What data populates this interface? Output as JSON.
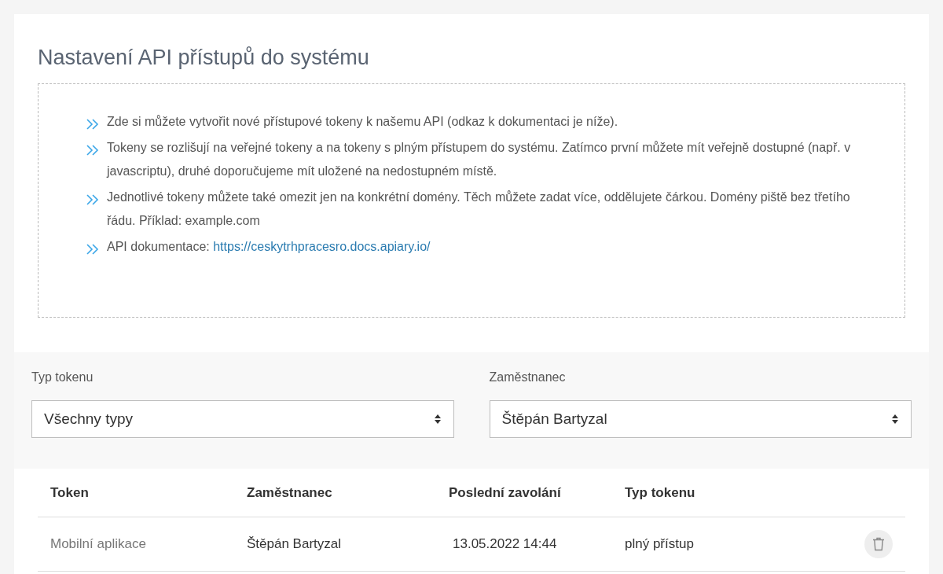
{
  "title": "Nastavení API přístupů do systému",
  "info_items": [
    {
      "text": "Zde si můžete vytvořit nové přístupové tokeny k našemu API (odkaz k dokumentaci je níže)."
    },
    {
      "text": "Tokeny se rozlišují na veřejné tokeny a na tokeny s plným přístupem do systému. Zatímco první můžete mít veřejně dostupné (např. v javascriptu), druhé doporučujeme mít uložené na nedostupném místě."
    },
    {
      "text": "Jednotlivé tokeny můžete také omezit jen na konkrétní domény. Těch můžete zadat více, oddělujete čárkou. Domény piště bez třetího řádu. Příklad: example.com"
    },
    {
      "text": "API dokumentace:",
      "link": "https://ceskytrhpracesro.docs.apiary.io/"
    }
  ],
  "filters": [
    {
      "label": "Typ tokenu",
      "value": "Všechny typy"
    },
    {
      "label": "Zaměstnanec",
      "value": "Štěpán Bartyzal"
    }
  ],
  "table": {
    "columns": [
      "Token",
      "Zaměstnanec",
      "Poslední zavolání",
      "Typ tokenu"
    ],
    "rows": [
      {
        "token": "Mobilní aplikace",
        "employee": "Štěpán Bartyzal",
        "last_call": "13.05.2022 14:44",
        "type": "plný přístup"
      }
    ]
  }
}
